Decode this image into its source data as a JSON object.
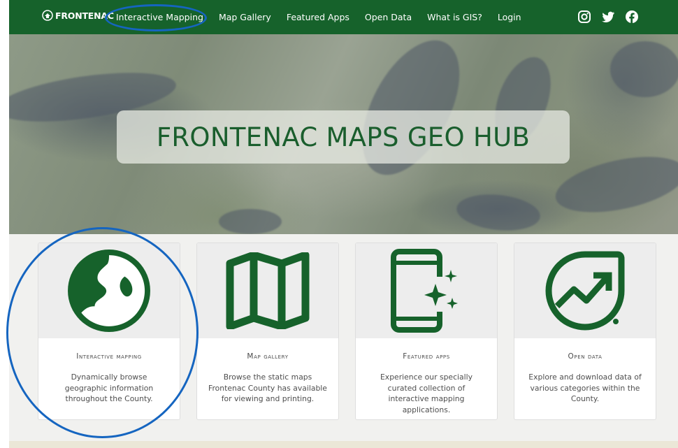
{
  "nav": {
    "brand": "FRONTENAC",
    "links": [
      "Interactive Mapping",
      "Map Gallery",
      "Featured Apps",
      "Open Data",
      "What is GIS?",
      "Login"
    ],
    "social_icons": [
      "instagram-icon",
      "twitter-icon",
      "facebook-icon"
    ]
  },
  "hero": {
    "title": "FRONTENAC MAPS GEO HUB"
  },
  "cards": [
    {
      "icon": "globe-icon",
      "title": "Interactive Mapping",
      "description": "Dynamically browse geographic information throughout the County."
    },
    {
      "icon": "map-icon",
      "title": "Map Gallery",
      "description": "Browse the static maps Frontenac County has available for viewing and printing."
    },
    {
      "icon": "phone-sparkle-icon",
      "title": "Featured Apps",
      "description": "Experience our specially curated collection of interactive mapping applications."
    },
    {
      "icon": "chart-trend-icon",
      "title": "Open Data",
      "description": "Explore and download data of various categories within the County."
    }
  ],
  "colors": {
    "brand_green": "#16622b",
    "annotation_blue": "#1565c0"
  }
}
